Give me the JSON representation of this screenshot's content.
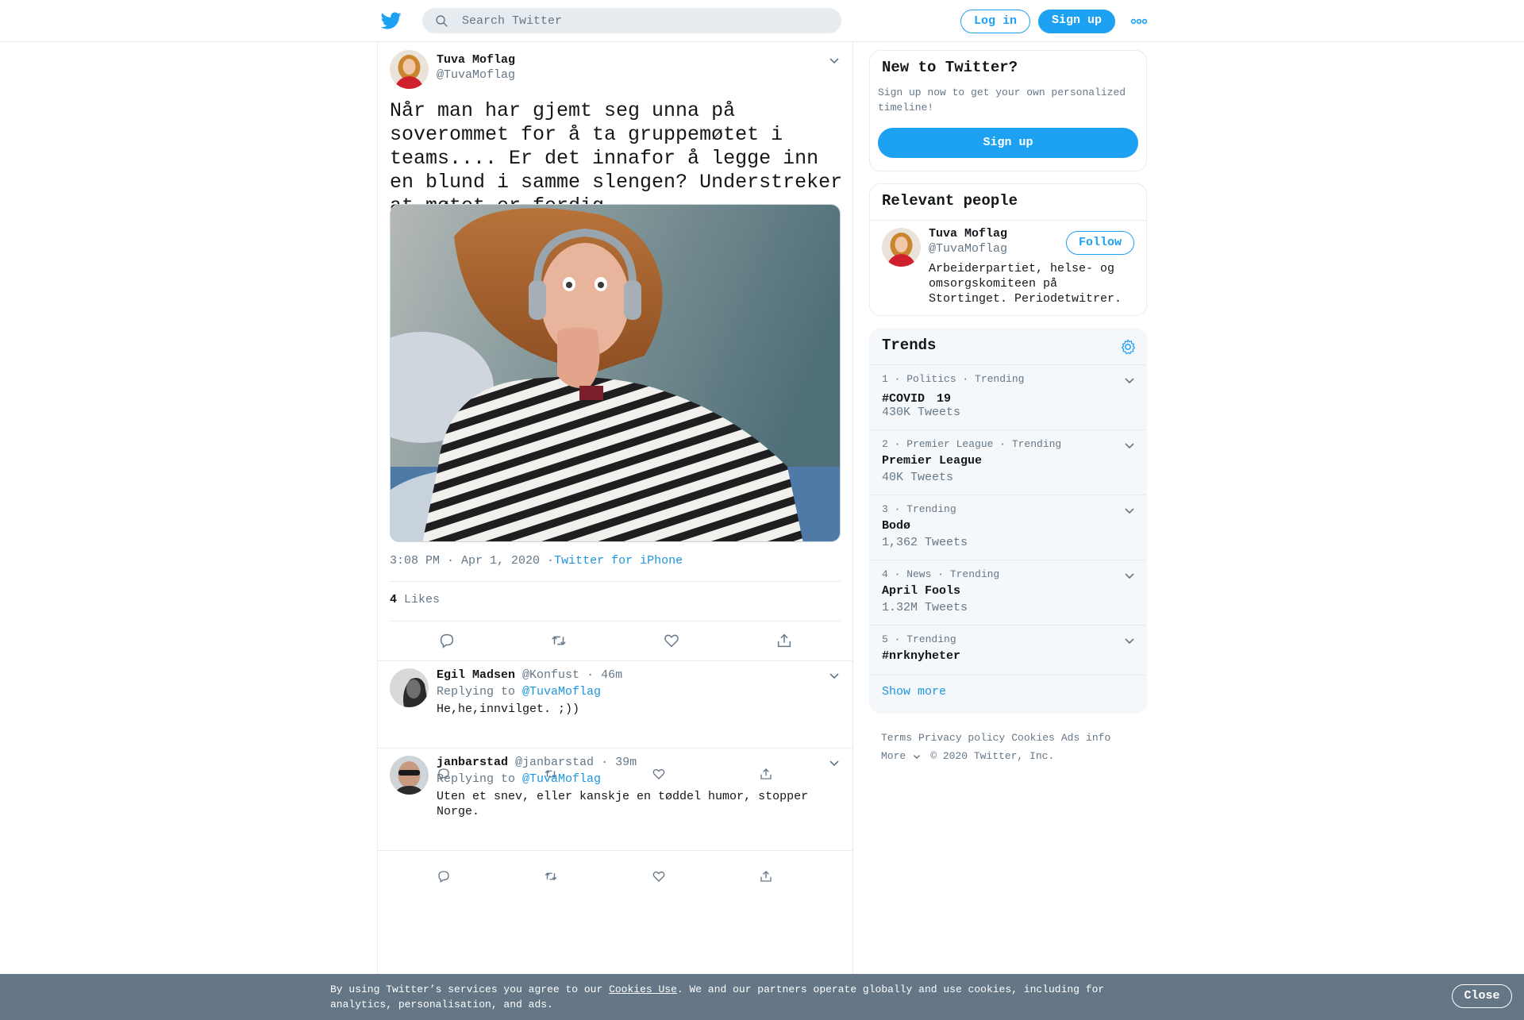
{
  "header": {
    "search_placeholder": "Search Twitter",
    "login_label": "Log in",
    "signup_label": "Sign up"
  },
  "tweet": {
    "author_name": "Tuva Moflag",
    "author_handle": "@TuvaMoflag",
    "text": "Når man har gjemt seg unna på soverommet for å ta gruppemøtet i teams.... Er det innafor å legge inn en blund i samme slengen? Understreker at møtet er ferdig.",
    "timestamp": "3:08 PM · Apr 1, 2020",
    "separator": "·",
    "source": "Twitter for iPhone",
    "likes_count": "4",
    "likes_label": "Likes"
  },
  "replies": [
    {
      "name": "Egil Madsen",
      "handle": "@Konfust",
      "time": "46m",
      "replying_to_label": "Replying to",
      "replying_to": "@TuvaMoflag",
      "text": "He,he,innvilget. ;))"
    },
    {
      "name": "janbarstad",
      "handle": "@janbarstad",
      "time": "39m",
      "replying_to_label": "Replying to",
      "replying_to": "@TuvaMoflag",
      "text": "Uten et snev, eller kanskje en tøddel humor, stopper Norge."
    }
  ],
  "sidebar": {
    "new_title": "New to Twitter?",
    "new_sub": "Sign up now to get your own personalized timeline!",
    "new_signup_label": "Sign up",
    "relevant_title": "Relevant people",
    "relevant": {
      "name": "Tuva Moflag",
      "handle": "@TuvaMoflag",
      "bio": "Arbeiderpartiet, helse- og omsorgskomiteen på Stortinget. Periodetwitrer.",
      "follow_label": "Follow"
    },
    "trends_title": "Trends",
    "trends": [
      {
        "meta": "1 · Politics · Trending",
        "name": "#COVID　19",
        "count": "430K Tweets"
      },
      {
        "meta": "2 · Premier League · Trending",
        "name": "Premier League",
        "count": "40K Tweets"
      },
      {
        "meta": "3 · Trending",
        "name": "Bodø",
        "count": "1,362 Tweets"
      },
      {
        "meta": "4 · News · Trending",
        "name": "April Fools",
        "count": "1.32M Tweets"
      },
      {
        "meta": "5 · Trending",
        "name": "#nrknyheter",
        "count": ""
      }
    ],
    "show_more": "Show more"
  },
  "footer": {
    "terms": "Terms",
    "privacy": "Privacy policy",
    "cookies": "Cookies",
    "ads": "Ads info",
    "more": "More",
    "copyright": "© 2020 Twitter, Inc."
  },
  "cookie_bar": {
    "text_before": "By using Twitter’s services you agree to our ",
    "link": "Cookies Use",
    "text_after": ". We and our partners operate globally and use cookies, including for analytics, personalisation, and ads.",
    "close_label": "Close"
  },
  "colors": {
    "brand_blue": "#1da1f2",
    "link_blue": "#1b95e0",
    "secondary_text": "#657786",
    "cookie_bar": "#657786"
  }
}
